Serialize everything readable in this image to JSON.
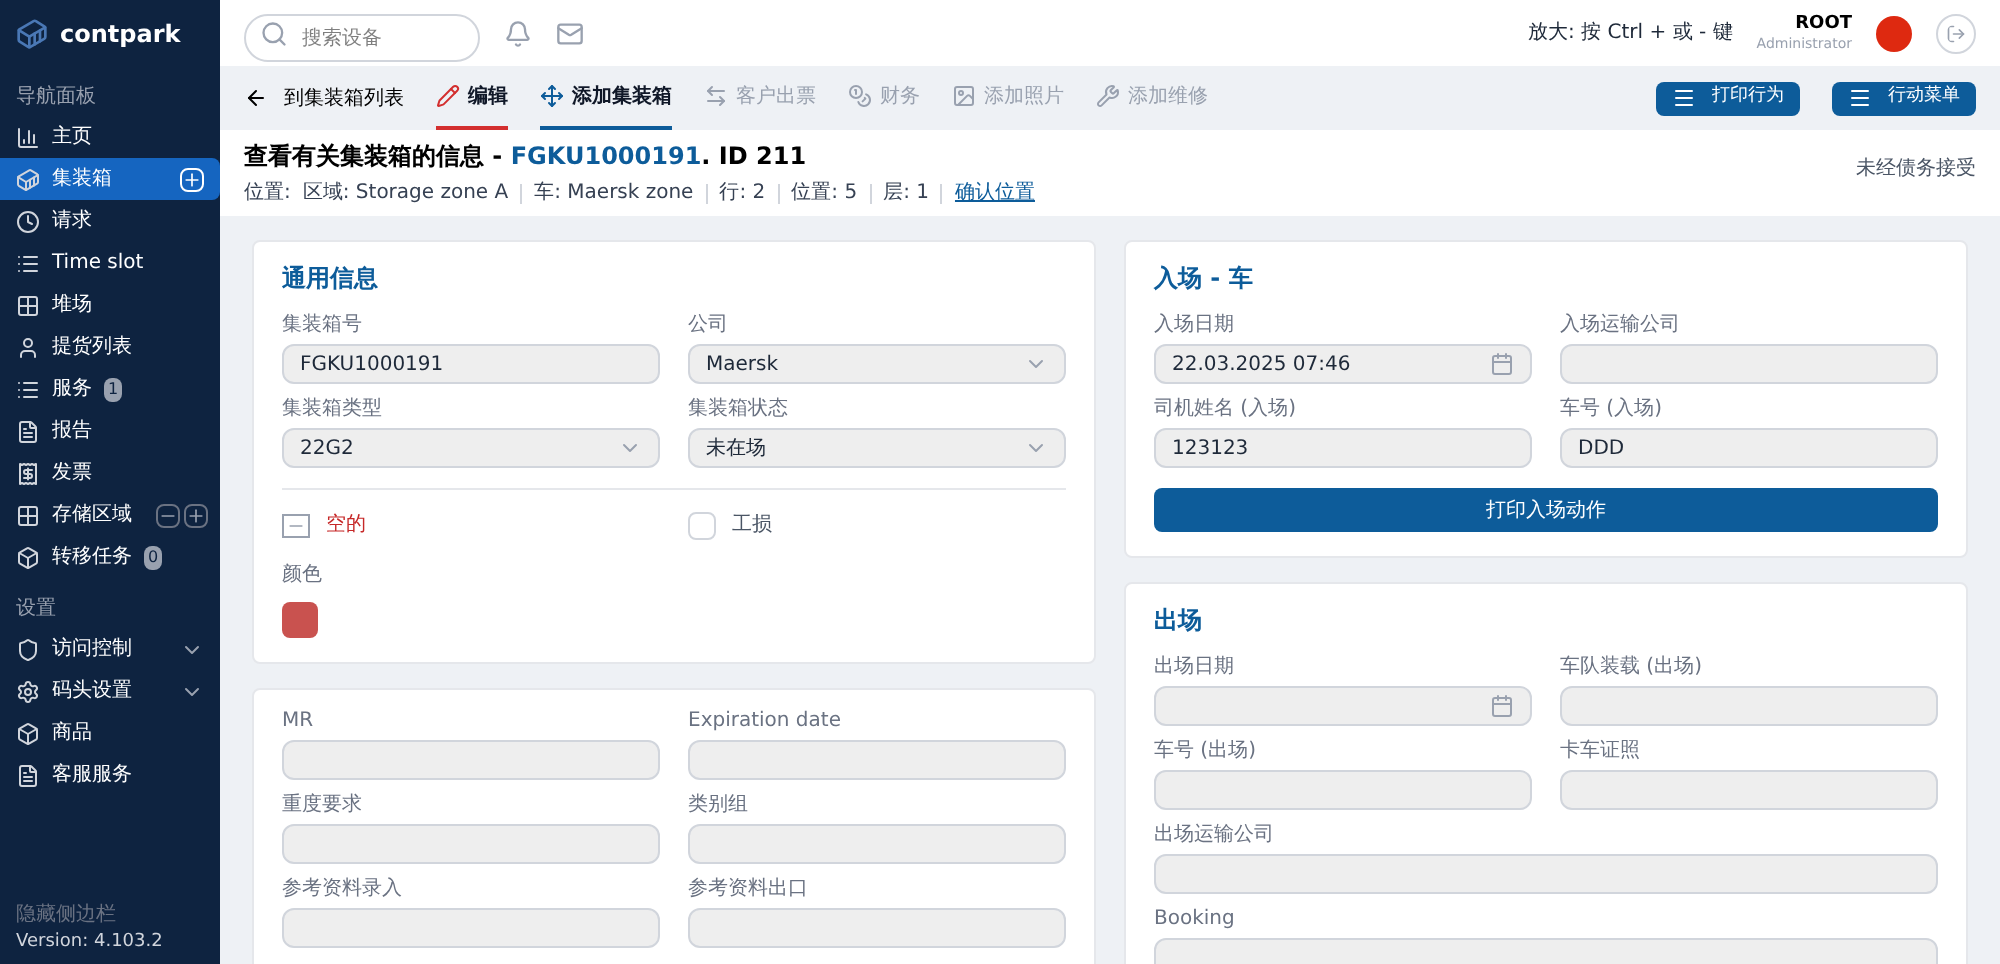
{
  "brand": {
    "name": "contpark"
  },
  "sidebar": {
    "sections": [
      {
        "title": "导航面板",
        "items": [
          {
            "label": "主页",
            "selected": false
          },
          {
            "label": "集装箱",
            "selected": true,
            "action": true
          },
          {
            "label": "请求",
            "selected": false
          },
          {
            "label": "Time slot",
            "selected": false
          },
          {
            "label": "堆场",
            "selected": false
          },
          {
            "label": "提货列表",
            "selected": false
          },
          {
            "label": "服务",
            "selected": false,
            "badge": "1"
          },
          {
            "label": "报告",
            "selected": false
          },
          {
            "label": "发票",
            "selected": false
          },
          {
            "label": "存储区域",
            "selected": false,
            "extras": true
          },
          {
            "label": "转移任务",
            "selected": false,
            "badge": "0"
          }
        ]
      },
      {
        "title": "设置",
        "items": [
          {
            "label": "访问控制",
            "selected": false,
            "expandable": true
          },
          {
            "label": "码头设置",
            "selected": false,
            "expandable": true
          },
          {
            "label": "商品",
            "selected": false
          },
          {
            "label": "客服服务",
            "selected": false
          }
        ]
      }
    ],
    "collapse": "隐藏侧边栏",
    "version": "Version: 4.103.2"
  },
  "topbar": {
    "search": {
      "placeholder": "搜索设备"
    },
    "zoom_hint": "放大: 按 Ctrl + 或 - 键",
    "user": {
      "name": "ROOT",
      "role": "Administrator"
    }
  },
  "toolbar": {
    "back": "到集装箱列表",
    "tabs": [
      {
        "label": "编辑",
        "kind": "edit",
        "selected": true
      },
      {
        "label": "添加集装箱",
        "kind": "page",
        "selected": true
      },
      {
        "label": "客户出票",
        "kind": "page",
        "selected": false
      },
      {
        "label": "财务",
        "kind": "page",
        "selected": false
      },
      {
        "label": "添加照片",
        "kind": "page",
        "selected": false
      },
      {
        "label": "添加维修",
        "kind": "page",
        "selected": false
      }
    ],
    "buttons": [
      "打印行为",
      "行动菜单"
    ]
  },
  "header": {
    "title_prefix": "查看有关集装箱的信息 - ",
    "container_number": "FGKU1000191",
    "title_suffix": ". ID 211",
    "location_label": "位置:",
    "location": [
      "区域: Storage zone A",
      "车: Maersk zone",
      "行: 2",
      "位置: 5",
      "层: 1"
    ],
    "location_link": "确认位置",
    "note": "未经债务接受"
  },
  "general": {
    "title": "通用信息",
    "fields": [
      {
        "label": "集装箱号",
        "value": "FGKU1000191",
        "kind": "text"
      },
      {
        "label": "公司",
        "value": "Maersk",
        "kind": "select"
      },
      {
        "label": "集装箱类型",
        "value": "22G2",
        "kind": "select"
      },
      {
        "label": "集装箱状态",
        "value": "未在场",
        "kind": "select"
      }
    ],
    "flags": [
      {
        "kind": "status",
        "label": "空的",
        "color": "#c62828"
      },
      {
        "kind": "checkbox",
        "label": "工损",
        "checked": false
      }
    ],
    "color_label": "颜色",
    "color": "#c9524f"
  },
  "extra": {
    "fields": [
      {
        "label": "MR",
        "kind": "text"
      },
      {
        "label": "Expiration date",
        "kind": "text"
      },
      {
        "label": "重度要求",
        "kind": "text"
      },
      {
        "label": "类别组",
        "kind": "text"
      },
      {
        "label": "参考资料录入",
        "kind": "text"
      },
      {
        "label": "参考资料出口",
        "kind": "text"
      }
    ]
  },
  "entry": {
    "title": "入场 - 车",
    "fields": [
      {
        "label": "入场日期",
        "value": "22.03.2025 07:46",
        "kind": "date"
      },
      {
        "label": "入场运输公司",
        "kind": "text"
      },
      {
        "label": "司机姓名 (入场)",
        "value": "123123",
        "kind": "text"
      },
      {
        "label": "车号 (入场)",
        "value": "DDD",
        "kind": "text"
      }
    ],
    "button": "打印入场动作"
  },
  "exit": {
    "title": "出场",
    "fields": [
      {
        "label": "出场日期",
        "kind": "date"
      },
      {
        "label": "车队装载 (出场)",
        "kind": "text"
      },
      {
        "label": "车号 (出场)",
        "kind": "text"
      },
      {
        "label": "卡车证照",
        "kind": "text"
      },
      {
        "label": "出场运输公司",
        "kind": "text",
        "wide": true
      },
      {
        "label": "Booking",
        "kind": "text",
        "wide": true
      }
    ]
  }
}
